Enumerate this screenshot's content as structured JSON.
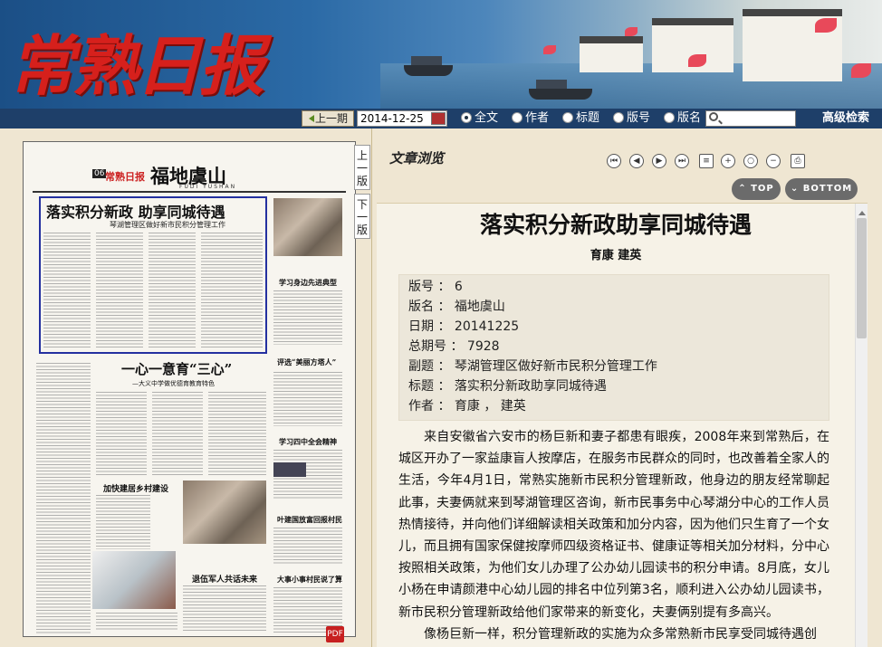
{
  "header": {
    "logo_text": "常熟日报"
  },
  "searchbar": {
    "prev_issue": "上一期",
    "date": "2014-12-25",
    "options": [
      {
        "label": "全文",
        "selected": true
      },
      {
        "label": "作者",
        "selected": false
      },
      {
        "label": "标题",
        "selected": false
      },
      {
        "label": "版号",
        "selected": false
      },
      {
        "label": "版名",
        "selected": false
      }
    ],
    "search_value": "",
    "advanced": "高级检索"
  },
  "page_view": {
    "side_tabs": [
      "上一版",
      "下一版"
    ],
    "section_name": "福地虞山",
    "section_en": "FUDI YUSHAN",
    "paper_logo": "常熟日报",
    "page_no": "06",
    "lead_title": "落实积分新政 助享同城待遇",
    "lead_sub": "琴湖管理区做好新市民积分管理工作",
    "headline_2": "一心一意育“三心”",
    "headline_2_sub": "—大义中学做优德育教育特色",
    "side_head_1": "学习身边先进典型",
    "side_head_2": "评选“美丽方塔人”",
    "side_head_3": "学习四中全会精神",
    "side_head_4": "叶建国放富回报村民",
    "side_head_5": "大事小事村民说了算",
    "mid_head_1": "加快建居乡村建设",
    "mid_head_2": "退伍军人共话未来",
    "pdf_icon": "PDF"
  },
  "preview": {
    "panel_title": "文章浏览",
    "tools": [
      "first-page-icon",
      "prev-page-icon",
      "next-page-icon",
      "last-page-icon",
      "copy-text-icon",
      "zoom-in-icon",
      "zoom-reset-icon",
      "zoom-out-icon",
      "print-icon"
    ],
    "top_button": "TOP",
    "bottom_button": "BOTTOM"
  },
  "article": {
    "title": "落实积分新政助享同城待遇",
    "author": "育康  建英",
    "meta": [
      {
        "label": "版号",
        "value": "6"
      },
      {
        "label": "版名",
        "value": "福地虞山"
      },
      {
        "label": "日期",
        "value": "20141225"
      },
      {
        "label": "总期号",
        "value": "7928"
      },
      {
        "label": "副题",
        "value": "琴湖管理区做好新市民积分管理工作"
      },
      {
        "label": "标题",
        "value": "落实积分新政助享同城待遇"
      },
      {
        "label": "作者",
        "value": "育康 ， 建英"
      }
    ],
    "paragraphs": [
      "来自安徽省六安市的杨巨新和妻子都患有眼疾，2008年来到常熟后，在城区开办了一家益康盲人按摩店，在服务市民群众的同时，也改善着全家人的生活，今年4月1日，常熟实施新市民积分管理新政，他身边的朋友经常聊起此事，夫妻俩就来到琴湖管理区咨询，新市民事务中心琴湖分中心的工作人员热情接待，并向他们详细解读相关政策和加分内容，因为他们只生育了一个女儿，而且拥有国家保健按摩师四级资格证书、健康证等相关加分材料，分中心按照相关政策，为他们女儿办理了公办幼儿园读书的积分申请。8月底，女儿小杨在申请颜港中心幼儿园的排名中位列第3名，顺利进入公办幼儿园读书，新市民积分管理新政给他们家带来的新变化，夫妻俩别提有多高兴。",
      "像杨巨新一样，积分管理新政的实施为众多常熟新市民享受同城待遇创"
    ]
  }
}
